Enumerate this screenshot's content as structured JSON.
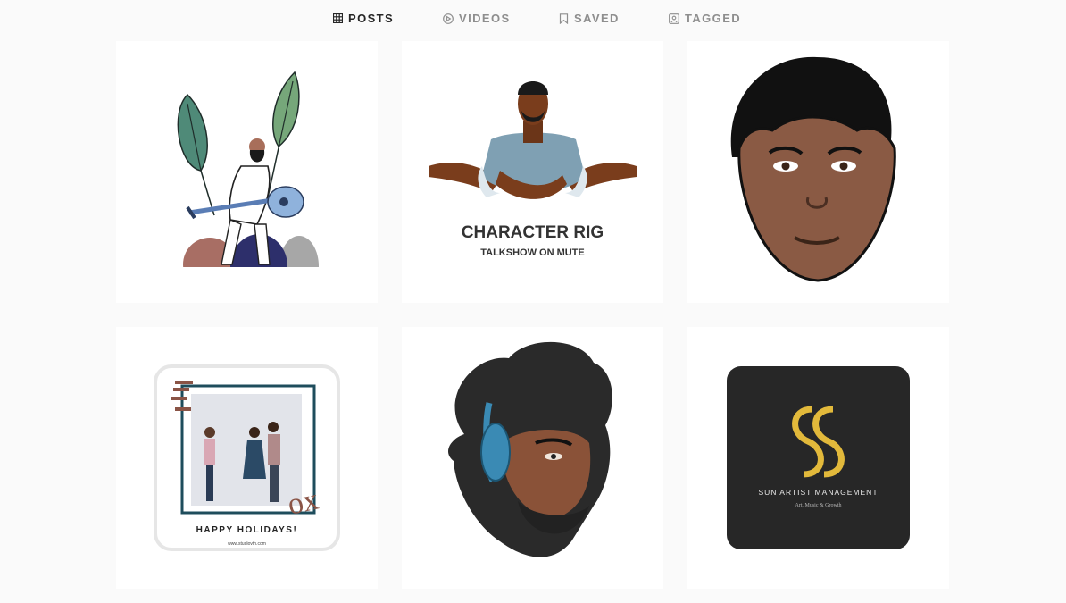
{
  "tabs": [
    {
      "label": "POSTS",
      "icon": "grid-icon",
      "active": true
    },
    {
      "label": "VIDEOS",
      "icon": "play-icon",
      "active": false
    },
    {
      "label": "SAVED",
      "icon": "bookmark-icon",
      "active": false
    },
    {
      "label": "TAGGED",
      "icon": "tag-user-icon",
      "active": false
    }
  ],
  "posts": [
    {
      "text": []
    },
    {
      "text": [
        "CHARACTER RIG",
        "TALKSHOW ON MUTE"
      ]
    },
    {
      "text": []
    },
    {
      "text": [
        "HAPPY HOLIDAYS!",
        "www.studiovth.com"
      ]
    },
    {
      "text": []
    },
    {
      "text": [
        "SUN ARTIST MANAGEMENT",
        "Art, Music & Growth"
      ]
    }
  ],
  "colors": {
    "active_tab": "#262626",
    "inactive_tab": "#8e8e8e",
    "background": "#fafafa",
    "sun_gold": "#e2b93b"
  }
}
